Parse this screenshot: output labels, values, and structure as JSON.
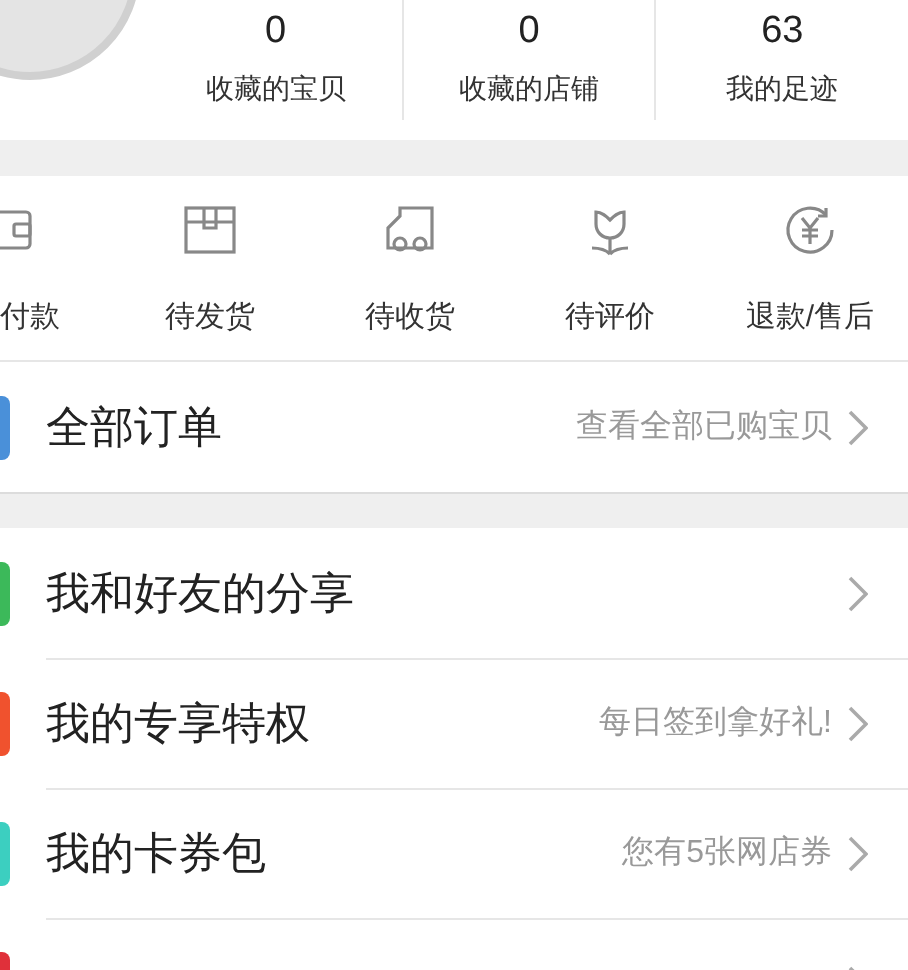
{
  "stats": [
    {
      "value": "0",
      "label": "收藏的宝贝"
    },
    {
      "value": "0",
      "label": "收藏的店铺"
    },
    {
      "value": "63",
      "label": "我的足迹"
    }
  ],
  "order_status": [
    {
      "kind": "wallet",
      "label": "付款"
    },
    {
      "kind": "box",
      "label": "待发货"
    },
    {
      "kind": "truck",
      "label": "待收货"
    },
    {
      "kind": "flower",
      "label": "待评价"
    },
    {
      "kind": "refund",
      "label": "退款/售后"
    }
  ],
  "all_orders": {
    "title": "全部订单",
    "hint": "查看全部已购宝贝",
    "color": "#4a90d9"
  },
  "menu": [
    {
      "title": "我和好友的分享",
      "color": "#3cb95a"
    },
    {
      "title": "我的专享特权",
      "hint": "每日签到拿好礼!",
      "color": "#f0522e"
    },
    {
      "title": "我的卡券包",
      "hint": "您有5张网店券",
      "color": "#3ccfc0"
    },
    {
      "color": "#e0303a"
    }
  ]
}
